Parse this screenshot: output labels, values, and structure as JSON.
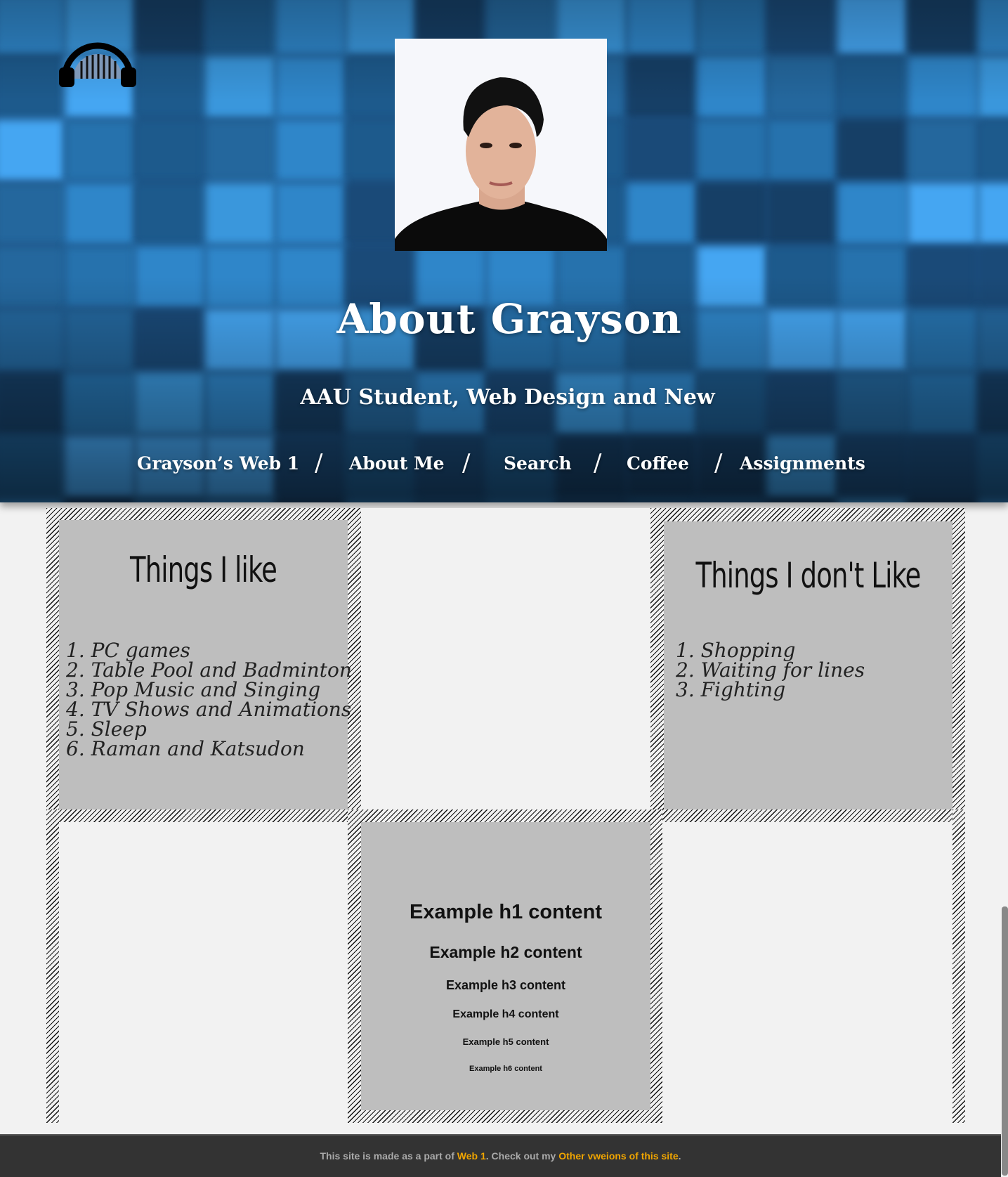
{
  "hero": {
    "title": "About Grayson",
    "subtitle": "AAU Student, Web Design and New",
    "logo_icon": "headphones-icon",
    "portrait_alt": "Grayson portrait"
  },
  "nav": {
    "items": [
      "Grayson’s Web 1",
      "About Me",
      "Search",
      "Coffee",
      "Assignments"
    ],
    "separator": "/"
  },
  "likes": {
    "heading": "Things I like",
    "items": [
      "1. PC games",
      "2. Table Pool and Badminton",
      "3. Pop Music and Singing",
      "4. TV Shows and Animations",
      "5. Sleep",
      "6. Raman and Katsudon"
    ]
  },
  "dislikes": {
    "heading": "Things I don't Like",
    "items": [
      "1. Shopping",
      "2. Waiting for lines",
      "3. Fighting"
    ]
  },
  "examples": {
    "h1": "Example h1 content",
    "h2": "Example h2 content",
    "h3": "Example h3 content",
    "h4": "Example h4 content",
    "h5": "Example h5 content",
    "h6": "Example h6 content"
  },
  "footer": {
    "text_before": "This site is made as a part of ",
    "link1": "Web 1",
    "text_middle": ". Check out my ",
    "link2": "Other vweions of this site",
    "text_after": "."
  },
  "colors": {
    "hero_blue": "#1d4f80",
    "tile_light": "#45a6f2",
    "panel_gray": "#bebebe",
    "footer_bg": "#333333",
    "footer_link": "#f0a500"
  }
}
